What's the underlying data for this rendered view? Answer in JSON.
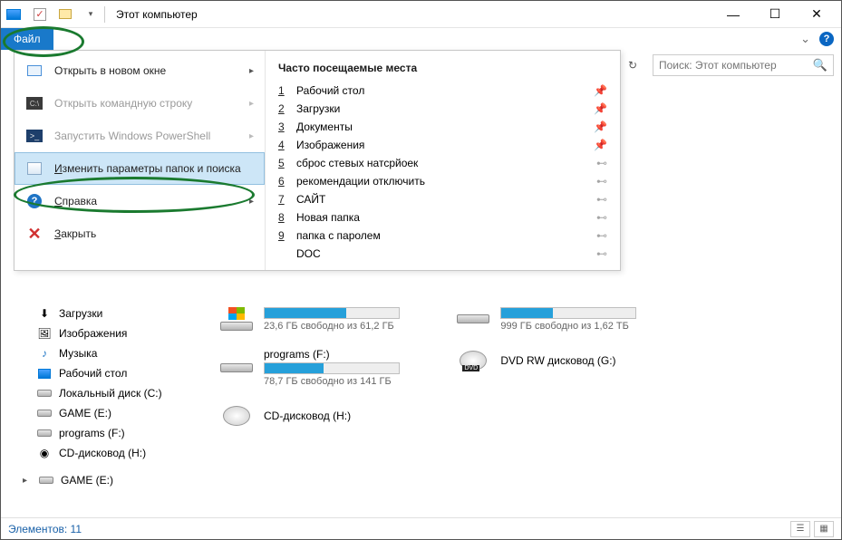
{
  "window": {
    "title": "Этот компьютер"
  },
  "ribbon": {
    "file_tab": "Файл"
  },
  "search": {
    "placeholder": "Поиск: Этот компьютер"
  },
  "file_menu": {
    "open_new_window": "Открыть в новом окне",
    "open_cmd": "Открыть командную строку",
    "run_powershell": "Запустить Windows PowerShell",
    "folder_options": "Изменить параметры папок и поиска",
    "help": "Справка",
    "close": "Закрыть",
    "freq_header": "Часто посещаемые места",
    "freq": [
      {
        "n": "1",
        "label": "Рабочий стол",
        "pinned": true
      },
      {
        "n": "2",
        "label": "Загрузки",
        "pinned": true
      },
      {
        "n": "3",
        "label": "Документы",
        "pinned": true
      },
      {
        "n": "4",
        "label": "Изображения",
        "pinned": true
      },
      {
        "n": "5",
        "label": "сброс стевых натсрйоек",
        "pinned": false
      },
      {
        "n": "6",
        "label": "рекомендации отключить",
        "pinned": false
      },
      {
        "n": "7",
        "label": "САЙТ",
        "pinned": false
      },
      {
        "n": "8",
        "label": "Новая папка",
        "pinned": false
      },
      {
        "n": "9",
        "label": "папка с паролем",
        "pinned": false
      },
      {
        "n": "",
        "label": "DOC",
        "pinned": false
      }
    ]
  },
  "nav": [
    {
      "label": "Загрузки",
      "icon": "downloads"
    },
    {
      "label": "Изображения",
      "icon": "pictures"
    },
    {
      "label": "Музыка",
      "icon": "music"
    },
    {
      "label": "Рабочий стол",
      "icon": "desktop"
    },
    {
      "label": "Локальный диск (C:)",
      "icon": "drive"
    },
    {
      "label": "GAME (E:)",
      "icon": "drive"
    },
    {
      "label": "programs (F:)",
      "icon": "drive"
    },
    {
      "label": "CD-дисковод (H:)",
      "icon": "cd"
    }
  ],
  "nav_extra": {
    "label": "GAME (E:)"
  },
  "drives": [
    {
      "name": "",
      "sub": "23,6 ГБ свободно из 61,2 ГБ",
      "fill": 61
    },
    {
      "name": "",
      "sub": "999 ГБ свободно из 1,62 ТБ",
      "fill": 38
    },
    {
      "name": "programs (F:)",
      "sub": "78,7 ГБ свободно из 141 ГБ",
      "fill": 44
    },
    {
      "name": "DVD RW дисковод (G:)",
      "sub": "",
      "fill": -1,
      "type": "dvd"
    },
    {
      "name": "CD-дисковод (H:)",
      "sub": "",
      "fill": -1,
      "type": "cd"
    }
  ],
  "status": {
    "text": "Элементов: 11"
  }
}
